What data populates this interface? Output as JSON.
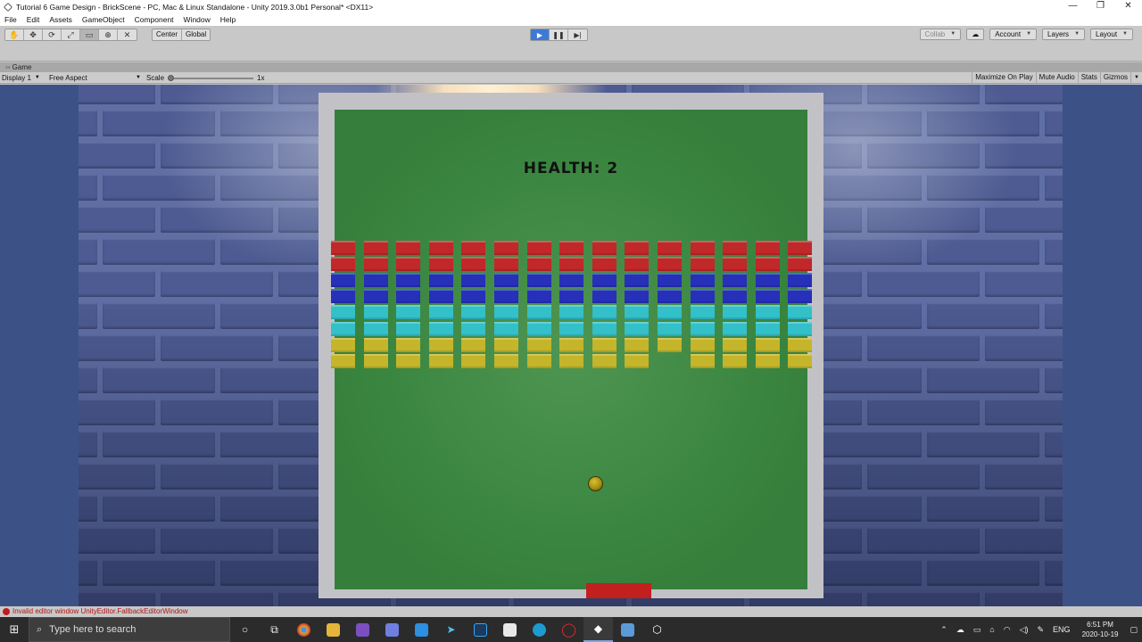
{
  "window": {
    "title": "Tutorial 6 Game Design - BrickScene - PC, Mac & Linux Standalone - Unity 2019.3.0b1 Personal* <DX11>",
    "controls": [
      "—",
      "❐",
      "✕"
    ]
  },
  "menu": [
    "File",
    "Edit",
    "Assets",
    "GameObject",
    "Component",
    "Window",
    "Help"
  ],
  "toolbar": {
    "tools": [
      "✋",
      "✥",
      "⟳",
      "⤢",
      "▭",
      "⊕",
      "✕"
    ],
    "pivot_center": "Center",
    "pivot_global": "Global",
    "play": "▶",
    "pause": "❚❚",
    "step": "▶|",
    "collab": "Collab",
    "account": "Account",
    "layers": "Layers",
    "layout": "Layout"
  },
  "game_view": {
    "tab_label": "Game",
    "display": "Display 1",
    "aspect": "Free Aspect",
    "scale_label": "Scale",
    "scale_value": "1x",
    "scale_level": 0.0,
    "maximize_on_play": "Maximize On Play",
    "mute_audio": "Mute Audio",
    "stats": "Stats",
    "gizmos": "Gizmos"
  },
  "game": {
    "health_text": "HEALTH: 2",
    "brick_colors": [
      "#c0282a",
      "#c0282a",
      "#2630b8",
      "#2630b8",
      "#33c0c8",
      "#33c0c8",
      "#c4b52a",
      "#c4b52a"
    ],
    "columns": 15,
    "missing_bricks": [
      [
        7,
        10
      ]
    ]
  },
  "console": {
    "message": "Invalid editor window UnityEditor.FallbackEditorWindow"
  },
  "taskbar": {
    "search_placeholder": "Type here to search",
    "lang": "ENG",
    "time": "6:51 PM",
    "date": "2020-10-19"
  }
}
